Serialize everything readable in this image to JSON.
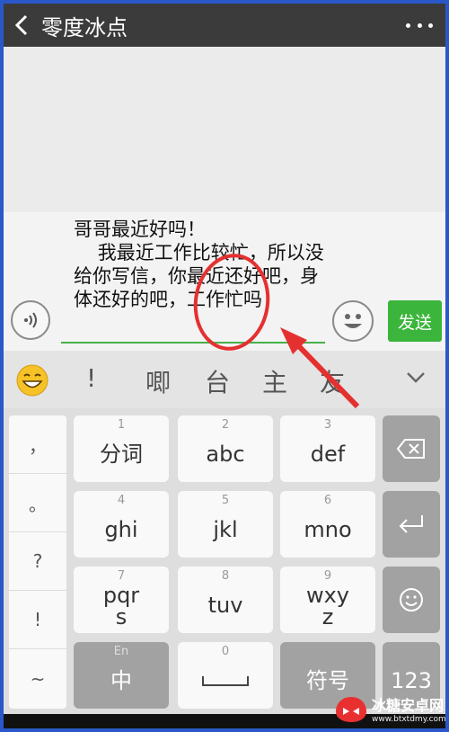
{
  "header": {
    "title": "零度冰点",
    "back_icon": "chevron-left-icon",
    "more_icon": "more-dots-icon"
  },
  "composer": {
    "text": "哥哥最近好吗！\n    我最近工作比较忙，所以没给你写信，你最近还好吧，身体还好的吧，工作忙吗",
    "send_label": "发送",
    "accent": "#3bb53b"
  },
  "candidates": {
    "items": [
      "!",
      "唧",
      "台",
      "主",
      "友"
    ]
  },
  "keyboard": {
    "punctuation": [
      "，",
      "。",
      "?",
      "!",
      "~"
    ],
    "keys": [
      {
        "num": "1",
        "label": "分词"
      },
      {
        "num": "2",
        "label": "abc"
      },
      {
        "num": "3",
        "label": "def"
      },
      {
        "num": "4",
        "label": "ghi"
      },
      {
        "num": "5",
        "label": "jkl"
      },
      {
        "num": "6",
        "label": "mno"
      },
      {
        "num": "7",
        "label": "pqr\ns"
      },
      {
        "num": "8",
        "label": "tuv"
      },
      {
        "num": "9",
        "label": "wxy\nz"
      }
    ],
    "lang_hint": "En",
    "lang_label": "中",
    "space_num": "0",
    "symbol_label": "符号",
    "numeric_label": "123"
  },
  "watermark": {
    "title": "冰糖安卓网",
    "url": "www.btxtdmy.com"
  },
  "annotation": {
    "color": "#e53030"
  }
}
